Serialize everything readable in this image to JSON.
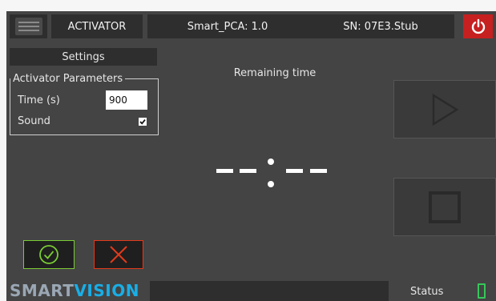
{
  "header": {
    "app_title": "ACTIVATOR",
    "model": "Smart_PCA: 1.0",
    "serial": "SN: 07E3.Stub",
    "icons": {
      "menu": "hamburger-menu-icon",
      "power": "power-icon"
    },
    "power_color": "#c62020"
  },
  "settings": {
    "title": "Settings",
    "group_title": "Activator Parameters",
    "time_label": "Time (s)",
    "time_value": "900",
    "sound_label": "Sound",
    "sound_checked": true
  },
  "timer": {
    "label": "Remaining time",
    "display": "--:--"
  },
  "controls": {
    "play_icon": "play-icon",
    "stop_icon": "stop-icon",
    "confirm_icon": "check-circle-icon",
    "cancel_icon": "close-x-icon",
    "confirm_color": "#7acb35",
    "cancel_color": "#e23a1c"
  },
  "footer": {
    "logo_part1": "SMART",
    "logo_part2": "VISION",
    "status_label": "Status",
    "status_color": "#36c75a"
  }
}
